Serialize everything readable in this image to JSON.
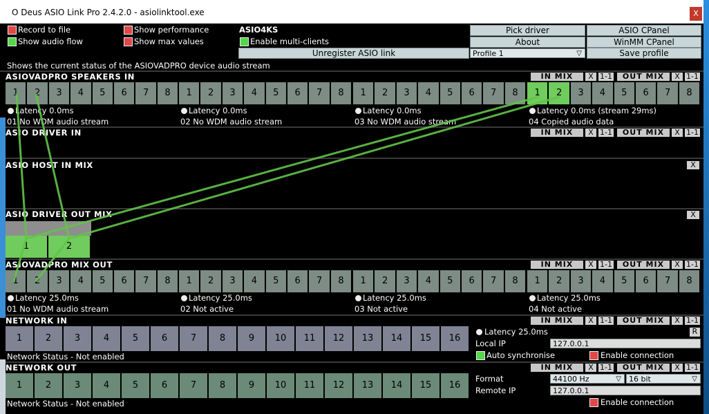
{
  "window": {
    "title": "O Deus ASIO Link Pro 2.4.2.0 - asiolinktool.exe",
    "close": "X"
  },
  "top": {
    "record_to_file": "Record to file",
    "show_audio_flow": "Show audio flow",
    "show_performance": "Show performance",
    "show_max_values": "Show max values",
    "driver_name": "ASIO4KS",
    "enable_multi_clients": "Enable multi-clients",
    "unregister": "Unregister ASIO link",
    "pick_driver": "Pick driver",
    "asio_cpanel": "ASIO CPanel",
    "about": "About",
    "winmm_cpanel": "WinMM CPanel",
    "profile": "Profile 1",
    "save_profile": "Save profile"
  },
  "status": "Shows the current status of the ASIOVADPRO device audio stream",
  "header_buttons": {
    "in_mix": "IN MIX",
    "out_mix": "OUT MIX",
    "one_to_one": "1-1",
    "x": "X"
  },
  "speakers_in": {
    "title": "ASIOVADPRO SPEAKERS IN",
    "groups": [
      {
        "latency": "Latency 0.0ms",
        "label": "01 No WDM audio stream"
      },
      {
        "latency": "Latency 0.0ms",
        "label": "02 No WDM audio stream"
      },
      {
        "latency": "Latency 0.0ms",
        "label": "03 No WDM audio stream"
      },
      {
        "latency": "Latency 0.0ms (stream 29ms)",
        "label": "04 Copied audio data"
      }
    ],
    "channels": [
      "1",
      "2",
      "3",
      "4",
      "5",
      "6",
      "7",
      "8"
    ]
  },
  "driver_in": {
    "title": "ASIO DRIVER IN"
  },
  "host_in_mix": {
    "title": "ASIO HOST IN MIX"
  },
  "driver_out_mix": {
    "title": "ASIO DRIVER OUT MIX",
    "channels": [
      "1",
      "2"
    ]
  },
  "mix_out": {
    "title": "ASIOVADPRO MIX OUT",
    "groups": [
      {
        "latency": "Latency 25.0ms",
        "label": "01 No WDM audio stream"
      },
      {
        "latency": "Latency 25.0ms",
        "label": "02 Not active"
      },
      {
        "latency": "Latency 25.0ms",
        "label": "03 Not active"
      },
      {
        "latency": "Latency 25.0ms",
        "label": "04 Not active"
      }
    ],
    "channels": [
      "1",
      "2",
      "3",
      "4",
      "5",
      "6",
      "7",
      "8"
    ]
  },
  "network_in": {
    "title": "NETWORK IN",
    "channels": [
      "1",
      "2",
      "3",
      "4",
      "5",
      "6",
      "7",
      "8",
      "9",
      "10",
      "11",
      "12",
      "13",
      "14",
      "15",
      "16"
    ],
    "status": "Network Status - Not enabled",
    "latency": "Latency 25.0ms",
    "r_button": "R",
    "local_ip_label": "Local IP",
    "local_ip": "127.0.0.1",
    "auto_sync": "Auto synchronise",
    "enable_connection": "Enable connection"
  },
  "network_out": {
    "title": "NETWORK OUT",
    "channels": [
      "1",
      "2",
      "3",
      "4",
      "5",
      "6",
      "7",
      "8",
      "9",
      "10",
      "11",
      "12",
      "13",
      "14",
      "15",
      "16"
    ],
    "status": "Network Status - Not enabled",
    "format_label": "Format",
    "format_rate": "44100 Hz",
    "format_bits": "16 bit",
    "remote_ip_label": "Remote IP",
    "remote_ip": "127.0.0.1",
    "enable_connection": "Enable connection"
  },
  "colors": {
    "cell_grey": "#7d8c85",
    "cell_active": "#70cc5c",
    "net_in_cell": "#808393",
    "net_out_cell": "#6b8a78"
  }
}
